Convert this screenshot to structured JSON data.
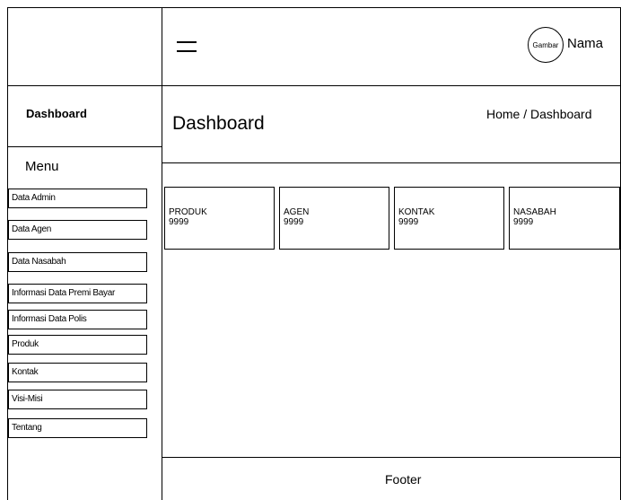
{
  "topbar": {
    "menu_icon": "hamburger-icon",
    "avatar_label": "Gambar",
    "user_name": "Nama"
  },
  "sidebar": {
    "brand": "Dashboard",
    "menu_heading": "Menu",
    "items": [
      {
        "label": "Data Admin"
      },
      {
        "label": "Data Agen"
      },
      {
        "label": "Data Nasabah"
      },
      {
        "label": "Informasi Data Premi Bayar"
      },
      {
        "label": "Informasi Data Polis"
      },
      {
        "label": "Produk"
      },
      {
        "label": "Kontak"
      },
      {
        "label": "Visi-Misi"
      },
      {
        "label": "Tentang"
      }
    ]
  },
  "main": {
    "title": "Dashboard",
    "breadcrumb": "Home / Dashboard",
    "cards": [
      {
        "label": "PRODUK",
        "value": "9999"
      },
      {
        "label": "AGEN",
        "value": "9999"
      },
      {
        "label": "KONTAK",
        "value": "9999"
      },
      {
        "label": "NASABAH",
        "value": "9999"
      }
    ]
  },
  "footer": {
    "text": "Footer"
  }
}
